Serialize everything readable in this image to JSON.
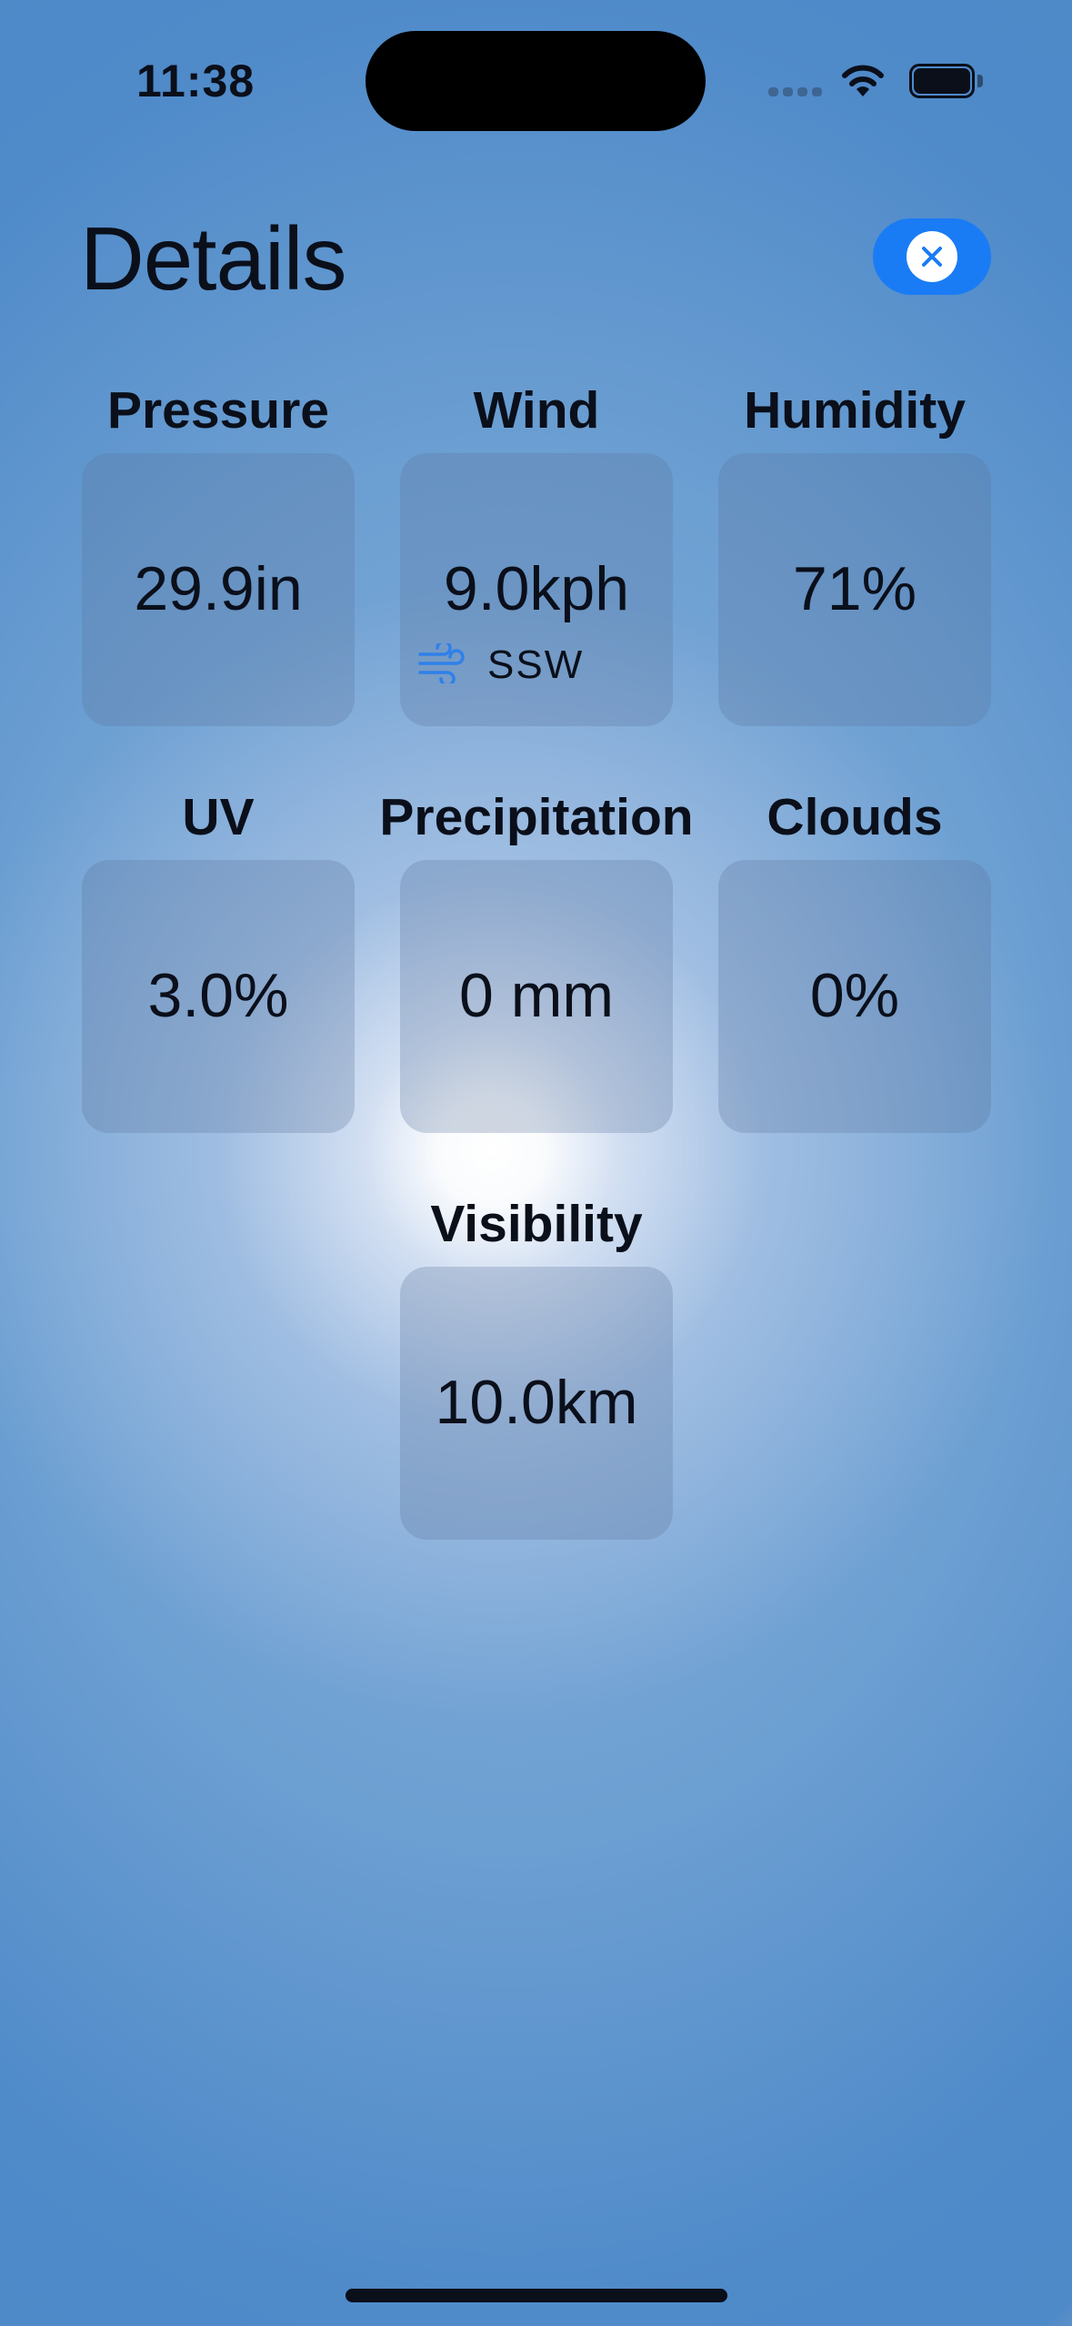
{
  "status_bar": {
    "time": "11:38"
  },
  "header": {
    "title": "Details"
  },
  "metrics": {
    "pressure": {
      "label": "Pressure",
      "value": "29.9in"
    },
    "wind": {
      "label": "Wind",
      "value": "9.0kph",
      "direction": "SSW",
      "icon": "wind-icon"
    },
    "humidity": {
      "label": "Humidity",
      "value": "71%"
    },
    "uv": {
      "label": "UV",
      "value": "3.0%"
    },
    "precipitation": {
      "label": "Precipitation",
      "value": "0 mm"
    },
    "clouds": {
      "label": "Clouds",
      "value": "0%"
    },
    "visibility": {
      "label": "Visibility",
      "value": "10.0km"
    }
  },
  "colors": {
    "accent": "#1a7cf5",
    "wind_icon": "#2f80ea"
  }
}
